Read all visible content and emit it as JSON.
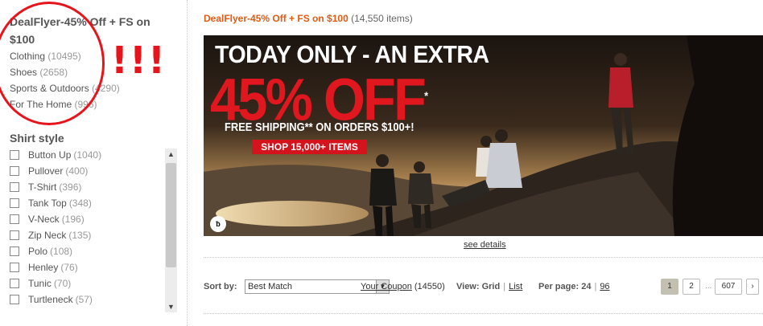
{
  "categories": {
    "title": "DealFlyer-45% Off + FS on $100",
    "items": [
      {
        "label": "Clothing",
        "count": "(10495)"
      },
      {
        "label": "Shoes",
        "count": "(2658)"
      },
      {
        "label": "Sports & Outdoors",
        "count": "(4290)"
      },
      {
        "label": "For The Home",
        "count": "(996)"
      }
    ],
    "annotation": "!!!",
    "annotation_color": "#e8141b"
  },
  "shirt_style": {
    "title": "Shirt style",
    "options": [
      {
        "label": "Button Up",
        "count": "(1040)"
      },
      {
        "label": "Pullover",
        "count": "(400)"
      },
      {
        "label": "T-Shirt",
        "count": "(396)"
      },
      {
        "label": "Tank Top",
        "count": "(348)"
      },
      {
        "label": "V-Neck",
        "count": "(196)"
      },
      {
        "label": "Zip Neck",
        "count": "(135)"
      },
      {
        "label": "Polo",
        "count": "(108)"
      },
      {
        "label": "Henley",
        "count": "(76)"
      },
      {
        "label": "Tunic",
        "count": "(70)"
      },
      {
        "label": "Turtleneck",
        "count": "(57)"
      }
    ]
  },
  "header": {
    "deal_title": "DealFlyer-45% Off + FS on $100",
    "item_count": "(14,550 items)"
  },
  "banner": {
    "line1": "TODAY ONLY - AN EXTRA",
    "line2": "45% OFF",
    "line2_mark": "*",
    "line3": "FREE SHIPPING** ON ORDERS $100+!",
    "cta": "SHOP 15,000+ ITEMS",
    "logo": "ƀ",
    "see_details": "see details"
  },
  "toolbar": {
    "sort_label": "Sort by:",
    "sort_value": "Best Match",
    "coupon_link": "Your Coupon",
    "coupon_count": "(14550)",
    "view_label": "View:",
    "view_grid": "Grid",
    "view_list": "List",
    "perpage_label": "Per page:",
    "perpage_current": "24",
    "perpage_alt": "96"
  },
  "pagination": {
    "pages": [
      "1",
      "2"
    ],
    "ellipsis": "...",
    "last": "607",
    "next": "›",
    "current": "1"
  },
  "colors": {
    "accent_orange": "#e15a12",
    "banner_red": "#e0171f",
    "annotation_red": "#e8141b"
  }
}
